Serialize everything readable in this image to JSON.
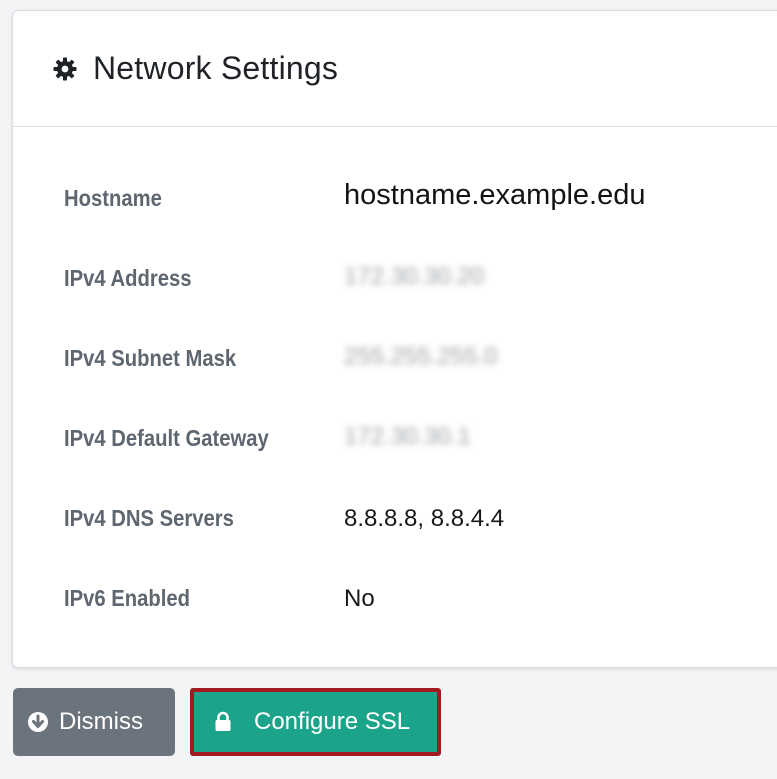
{
  "card": {
    "title": "Network Settings",
    "icon": "gear-icon"
  },
  "settings": [
    {
      "label": "Hostname",
      "value": "hostname.example.edu"
    },
    {
      "label": "IPv4 Address",
      "value": "172.30.30.20"
    },
    {
      "label": "IPv4 Subnet Mask",
      "value": "255.255.255.0"
    },
    {
      "label": "IPv4 Default Gateway",
      "value": "172.30.30.1"
    },
    {
      "label": "IPv4 DNS Servers",
      "value": "8.8.8.8, 8.8.4.4"
    },
    {
      "label": "IPv6 Enabled",
      "value": "No"
    }
  ],
  "actions": {
    "dismiss_label": "Dismiss",
    "dismiss_icon": "arrow-down-circle-icon",
    "ssl_label": "Configure SSL",
    "ssl_icon": "lock-icon"
  },
  "colors": {
    "dismiss_bg": "#6b737c",
    "ssl_bg": "#1ba489",
    "highlight_border": "#a11a20"
  }
}
